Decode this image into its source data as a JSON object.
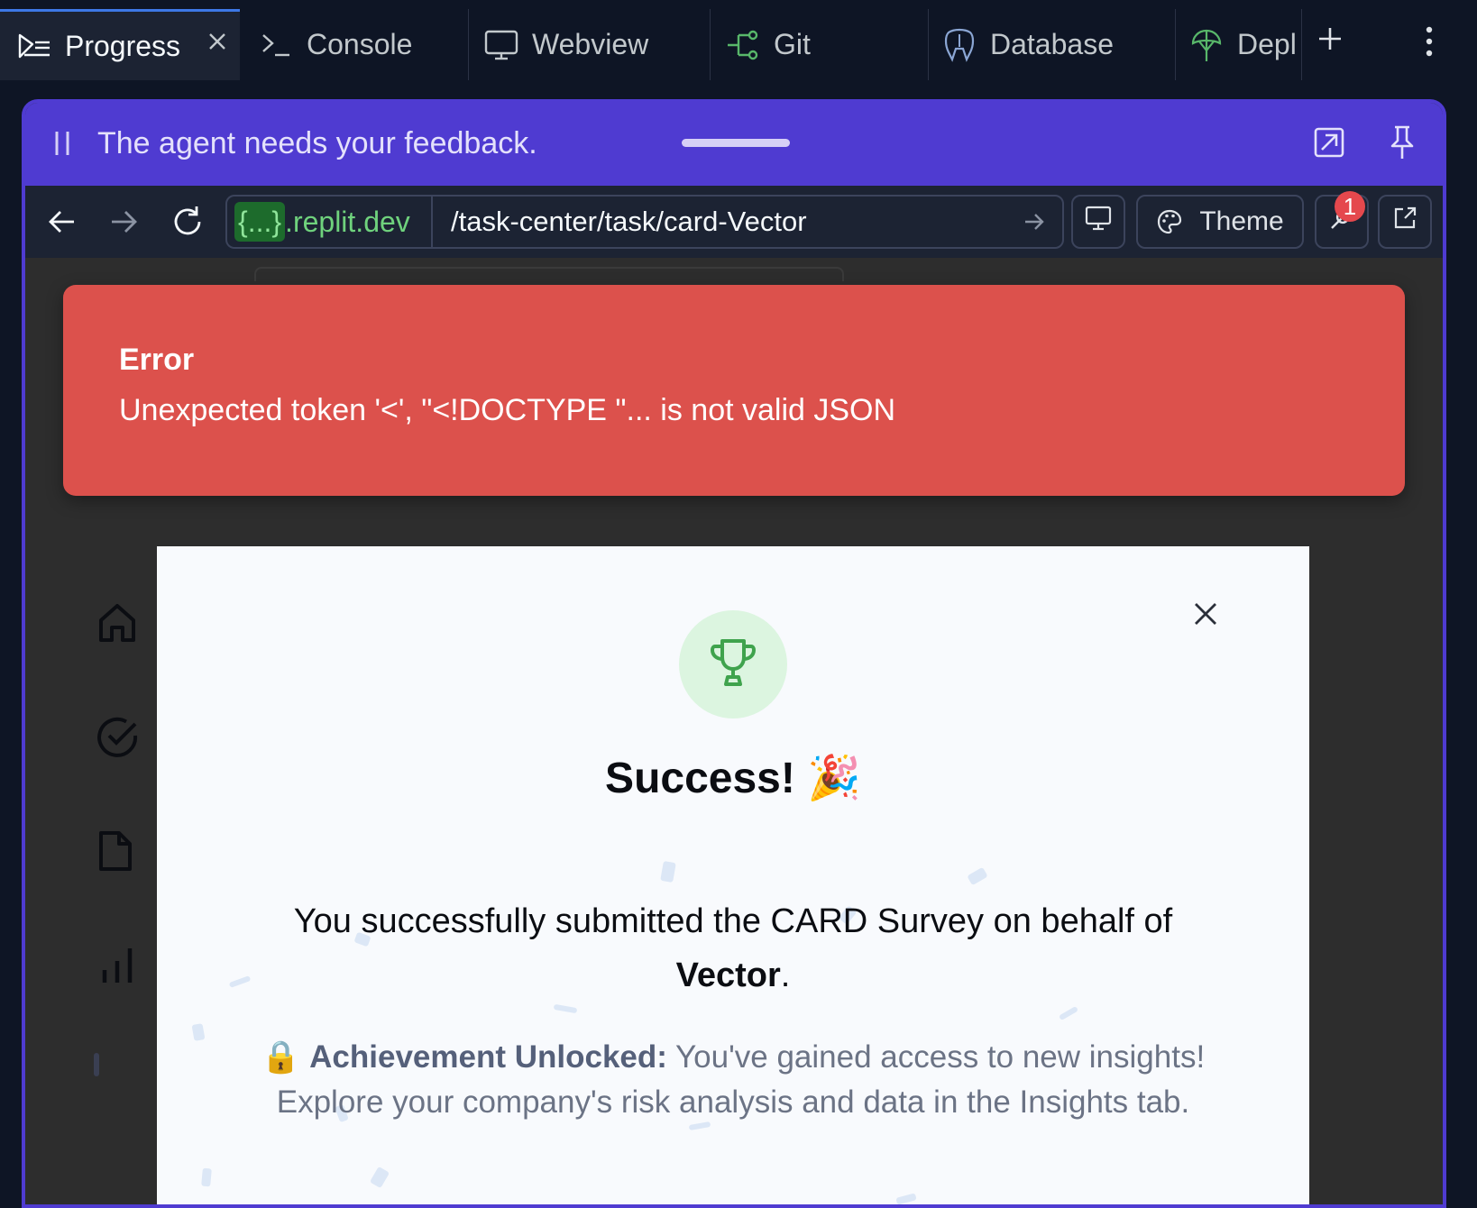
{
  "tabs": [
    {
      "label": "Progress",
      "icon": "progress-icon",
      "active": true
    },
    {
      "label": "Console",
      "icon": "console-icon"
    },
    {
      "label": "Webview",
      "icon": "monitor-icon"
    },
    {
      "label": "Git",
      "icon": "git-icon"
    },
    {
      "label": "Database",
      "icon": "database-icon"
    },
    {
      "label": "Depl",
      "icon": "deploy-icon"
    }
  ],
  "feedback_bar": {
    "message": "The agent needs your feedback.",
    "accent_color": "#4f3bd1"
  },
  "browser": {
    "domain_highlight": "{...}",
    "domain_rest": ".replit.dev",
    "path": "/task-center/task/card-Vector",
    "theme_label": "Theme",
    "devtools_badge": "1"
  },
  "page": {
    "percent_fragment": "%"
  },
  "error_toast": {
    "title": "Error",
    "message": "Unexpected token '<', \"<!DOCTYPE \"... is not valid JSON",
    "color": "#dc514c"
  },
  "modal": {
    "title": "Success! 🎉",
    "message_prefix": "You successfully submitted the CARD Survey on behalf of",
    "company": "Vector",
    "message_suffix": ".",
    "achievement_lock": "🔒",
    "achievement_label": "Achievement Unlocked:",
    "achievement_text": "You've gained access to new insights! Explore your company's risk analysis and data in the Insights tab.",
    "trophy_color": "#3fa34d"
  }
}
